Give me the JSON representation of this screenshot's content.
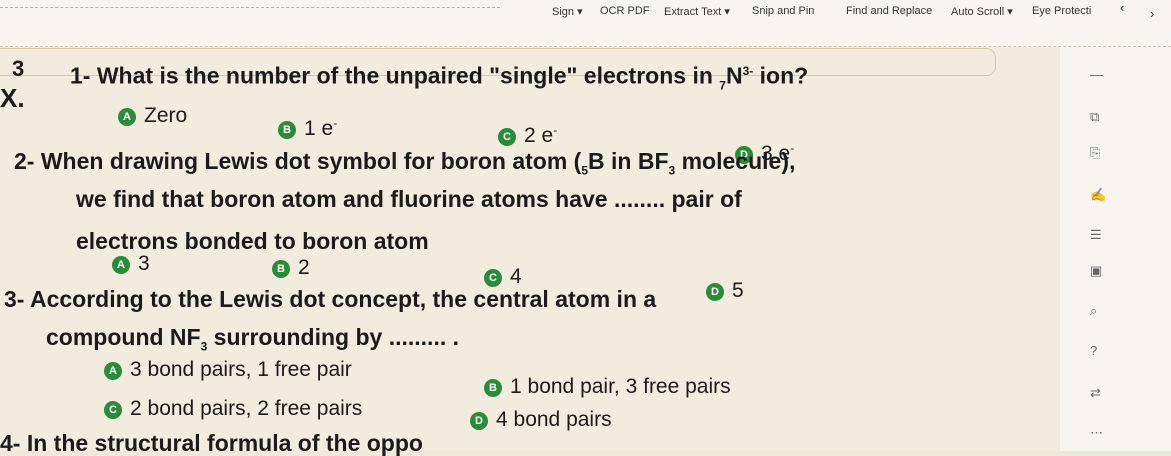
{
  "toolbar": {
    "items": [
      "Sign ▾",
      "OCR PDF",
      "Extract Text ▾",
      "Snip and Pin",
      "Find and Replace",
      "Auto Scroll ▾",
      "Eye Protecti"
    ]
  },
  "content": {
    "margin_number": "3",
    "margin_label": "X.",
    "q1": {
      "text": "1- What is the number of the unpaired \"single\" electrons in ",
      "sub": "7",
      "element": "N",
      "sup": "3-",
      "tail": " ion?",
      "options": [
        {
          "letter": "A",
          "text": "Zero"
        },
        {
          "letter": "B",
          "text": "1 e"
        },
        {
          "letter": "C",
          "text": "2 e"
        },
        {
          "letter": "D",
          "text": "3 e"
        }
      ]
    },
    "q2": {
      "line1": "2- When drawing Lewis dot symbol for boron atom (",
      "line1_sub": "5",
      "line1_mid": "B in BF",
      "line1_sub2": "3",
      "line1_tail": " molecule),",
      "line2": "we find that boron atom and fluorine atoms have ........ pair of",
      "line3": "electrons bonded to boron atom",
      "options": [
        {
          "letter": "A",
          "text": "3"
        },
        {
          "letter": "B",
          "text": "2"
        },
        {
          "letter": "C",
          "text": "4"
        },
        {
          "letter": "D",
          "text": "5"
        }
      ]
    },
    "q3": {
      "line1": "3- According to the Lewis dot concept, the central atom in a",
      "line2a": "compound NF",
      "line2_sub": "3",
      "line2b": " surrounding by ......... .",
      "options": [
        {
          "letter": "A",
          "text": "3 bond pairs, 1 free pair"
        },
        {
          "letter": "B",
          "text": "1 bond pair, 3 free pairs"
        },
        {
          "letter": "C",
          "text": "2 bond pairs, 2 free pairs"
        },
        {
          "letter": "D",
          "text": "4 bond pairs"
        }
      ]
    },
    "q4": {
      "text": "4- In the structural formula of the oppo"
    }
  },
  "sidebar": {
    "icons": [
      "minimize-icon",
      "external-icon",
      "bookmark-icon",
      "ink-icon",
      "list-icon",
      "page-icon",
      "search-icon",
      "help-icon",
      "compare-icon",
      "more-icon"
    ],
    "glyphs": [
      "—",
      "⧉",
      "⎘",
      "✍",
      "☰",
      "▣",
      "⌕",
      "?",
      "⇄",
      "⋯"
    ]
  }
}
